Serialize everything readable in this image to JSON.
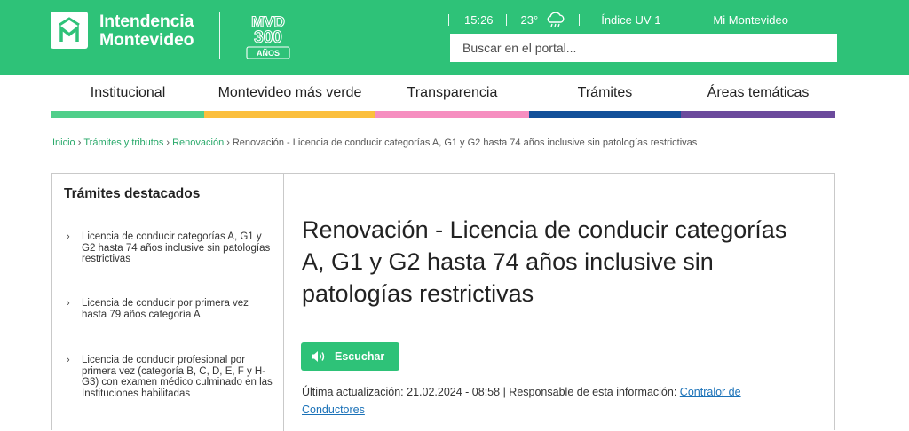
{
  "brand": {
    "name_line1": "Intendencia",
    "name_line2": "Montevideo",
    "badge_line1": "MVD",
    "badge_line2": "300",
    "badge_line3": "AÑOS",
    "color": "#2ec278"
  },
  "infobar": {
    "time": "15:26",
    "temperature": "23°",
    "weather_icon": "cloud-rain-icon",
    "uv": "Índice UV 1",
    "account_link": "Mi Montevideo"
  },
  "search": {
    "placeholder": "Buscar en el portal..."
  },
  "nav": [
    {
      "label": "Institucional",
      "color": "#4fcf8a"
    },
    {
      "label": "Montevideo más verde",
      "color": "#fbbf3d"
    },
    {
      "label": "Transparencia",
      "color": "#f68ec0"
    },
    {
      "label": "Trámites",
      "color": "#12509a"
    },
    {
      "label": "Áreas temáticas",
      "color": "#6b4a9c"
    }
  ],
  "breadcrumb": {
    "items": [
      "Inicio",
      "Trámites y tributos",
      "Renovación"
    ],
    "separator": "›",
    "current": "Renovación - Licencia de conducir categorías A, G1 y G2 hasta 74 años inclusive sin patologías restrictivas"
  },
  "sidebar": {
    "title": "Trámites destacados",
    "chevron": "›",
    "items": [
      "Licencia de conducir categorías A, G1 y G2 hasta 74 años inclusive sin patologías restrictivas",
      "Licencia de conducir por primera vez hasta 79 años categoría A",
      "Licencia de conducir profesional por primera vez (categoría B, C, D, E, F y H- G3) con examen médico culminado en las Instituciones habilitadas"
    ]
  },
  "main": {
    "title": "Renovación - Licencia de conducir categorías A, G1 y G2 hasta 74 años inclusive sin patologías restrictivas",
    "listen_label": "Escuchar",
    "updated_label": "Última actualización:",
    "updated_value": "21.02.2024 - 08:58",
    "responsible_label": "Responsable de esta información:",
    "responsible_link": "Contralor de Conductores"
  }
}
